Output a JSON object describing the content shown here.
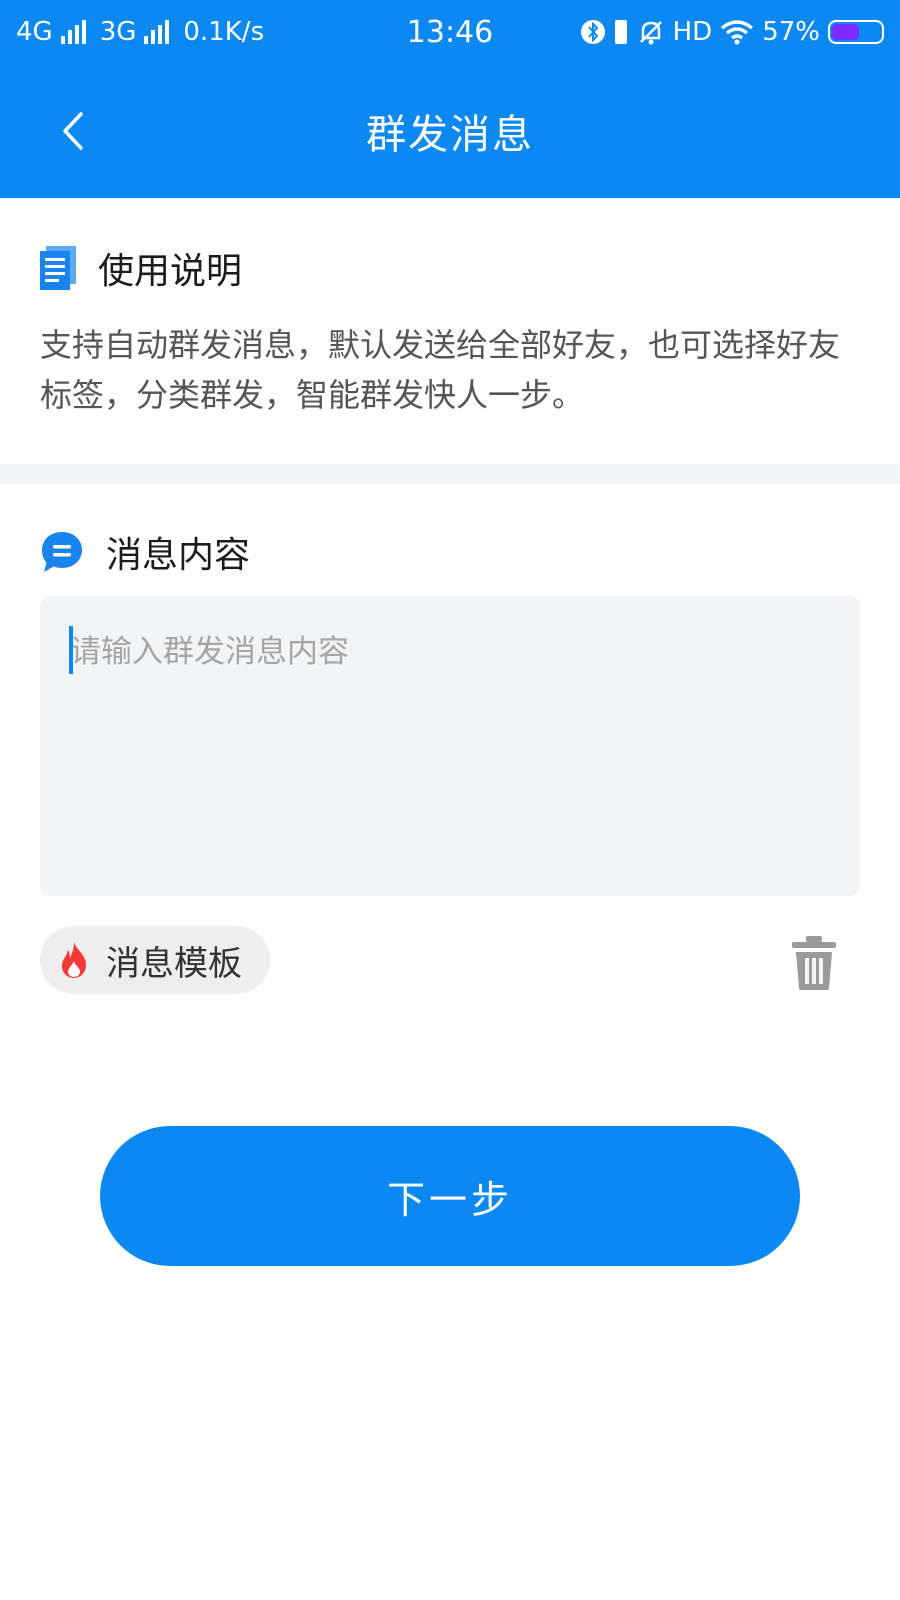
{
  "status_bar": {
    "network1": "4G",
    "network2": "3G",
    "speed": "0.1K/s",
    "time": "13:46",
    "hd": "HD",
    "battery_percent": "57%",
    "battery_level": 0.57,
    "icons": [
      "signal-icon",
      "bluetooth-icon",
      "vibrate-icon",
      "mute-bell-icon",
      "wifi-icon",
      "battery-icon"
    ]
  },
  "header": {
    "title": "群发消息",
    "back_icon": "chevron-left-icon"
  },
  "usage": {
    "heading": "使用说明",
    "icon": "document-icon",
    "description": "支持自动群发消息，默认发送给全部好友，也可选择好友标签，分类群发，智能群发快人一步。"
  },
  "message": {
    "heading": "消息内容",
    "icon": "chat-bubble-icon",
    "value": "",
    "placeholder": "请输入群发消息内容"
  },
  "template": {
    "label": "消息模板",
    "icon": "flame-icon"
  },
  "actions": {
    "delete_icon": "trash-icon",
    "next_label": "下一步"
  },
  "colors": {
    "primary": "#0b88f2",
    "flame": "#f33a3a",
    "input_bg": "#f3f4f6",
    "divider": "#f2f3f5"
  }
}
